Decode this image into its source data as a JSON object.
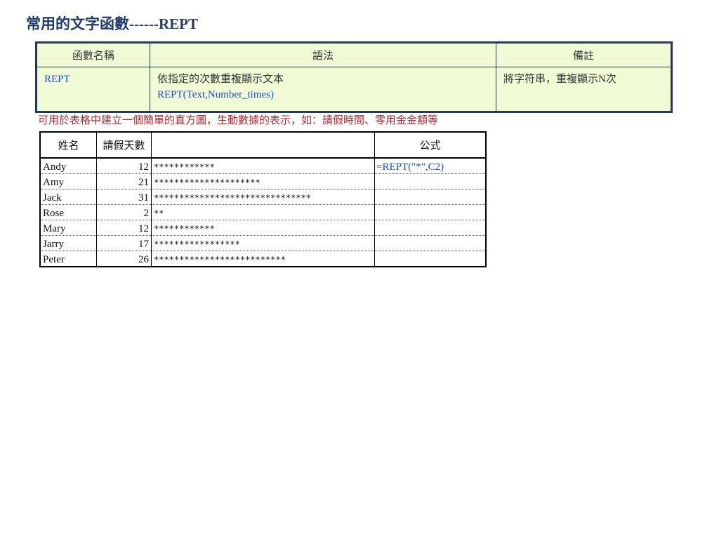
{
  "title": "常用的文字函數------REPT",
  "func_table": {
    "headers": [
      "函數名稱",
      "語法",
      "備註"
    ],
    "name": "REPT",
    "syntax_desc": "依指定的次數重複顯示文本",
    "syntax": "REPT(Text,Number_times)",
    "remark": "將字符串，重複顯示N次"
  },
  "note": "可用於表格中建立一個簡單的直方圖，生動數據的表示，如：請假時間、零用金金額等",
  "data_table": {
    "headers": [
      "姓名",
      "請假天數",
      "",
      "公式"
    ],
    "rows": [
      {
        "name": "Andy",
        "days": "12",
        "bar": "************",
        "formula": "=REPT(\"*\",C2)"
      },
      {
        "name": "Amy",
        "days": "21",
        "bar": "*********************",
        "formula": ""
      },
      {
        "name": "Jack",
        "days": "31",
        "bar": "*******************************",
        "formula": ""
      },
      {
        "name": "Rose",
        "days": "2",
        "bar": "**",
        "formula": ""
      },
      {
        "name": "Mary",
        "days": "12",
        "bar": "************",
        "formula": ""
      },
      {
        "name": "Jarry",
        "days": "17",
        "bar": "*****************",
        "formula": ""
      },
      {
        "name": "Peter",
        "days": "26",
        "bar": "**************************",
        "formula": ""
      }
    ]
  }
}
